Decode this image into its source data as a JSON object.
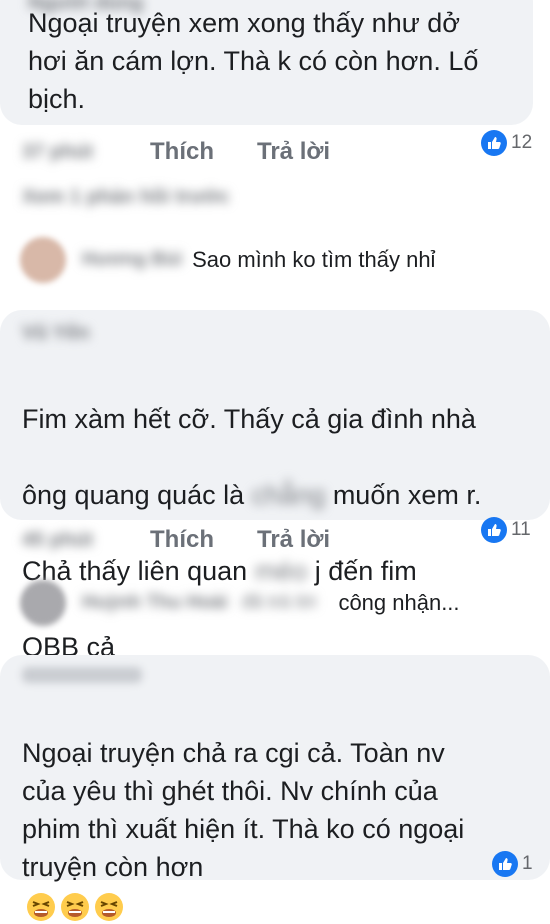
{
  "comments": [
    {
      "author": "Người dùng",
      "text": "Ngoại truyện xem xong thấy như dở\nhơi ăn cám lợn. Thà k có còn hơn. Lố\nbịch.",
      "time": "37 phút",
      "like_label": "Thích",
      "reply_label": "Trả lời",
      "reactions": "12",
      "view_replies": "Xem 1 phản hồi trước",
      "reply": {
        "author": "Hương Bùi",
        "text": "Sao mình ko tìm thấy nhỉ"
      }
    },
    {
      "author": "Vũ Yến",
      "text_line1": "Fim xàm hết cỡ. Thấy cả gia đình nhà",
      "text_line2a": "ông quang quác là",
      "text_hidden1": "chẳng",
      "text_line2b": "muốn xem r.",
      "text_line3a": "Chả thấy liên quan",
      "text_hidden2": "méo",
      "text_line3b": "j đến fim",
      "text_line4": "QBB cả",
      "time": "45 phút",
      "like_label": "Thích",
      "reply_label": "Trả lời",
      "reactions": "11",
      "reply": {
        "author": "Huỳnh Thu Hoài",
        "extra": "đã trả lời",
        "text": "công nhận..."
      }
    },
    {
      "author": "Người dùng",
      "text": "Ngoại truyện chả ra cgi cả. Toàn nv\ncủa yêu thì ghét thôi. Nv chính của\nphim thì xuất hiện ít. Thà ko có ngoại\ntruyện còn hơn",
      "reactions": "1"
    }
  ],
  "icons": {
    "like": "thumbs-up-icon",
    "emoji_neutral": "expressionless-face-icon",
    "emoji_tired": "tired-face-icon"
  },
  "colors": {
    "like_blue": "#1877f2",
    "bubble": "#f0f2f5"
  }
}
